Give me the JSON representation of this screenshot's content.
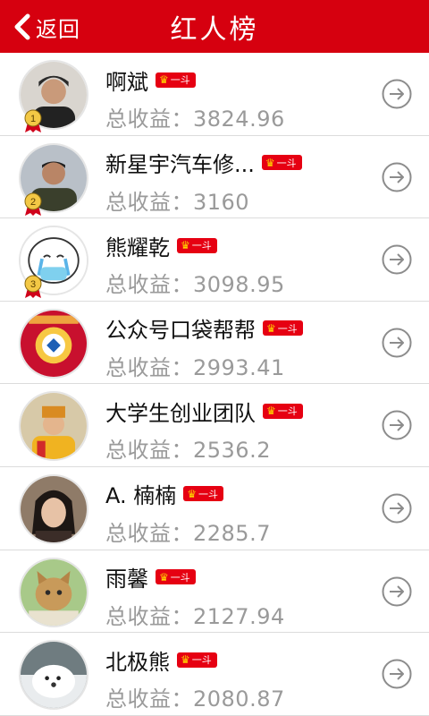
{
  "header": {
    "back_label": "返回",
    "title": "红人榜"
  },
  "income_prefix": "总收益：",
  "users": [
    {
      "name": "啊斌",
      "income": "3824.96",
      "badge": "一斗",
      "rank": "1"
    },
    {
      "name": "新星宇汽车修...",
      "income": "3160",
      "badge": "一斗",
      "rank": "2"
    },
    {
      "name": "熊耀乾",
      "income": "3098.95",
      "badge": "一斗",
      "rank": "3"
    },
    {
      "name": "公众号口袋帮帮",
      "income": "2993.41",
      "badge": "一斗",
      "rank": ""
    },
    {
      "name": "大学生创业团队",
      "income": "2536.2",
      "badge": "一斗",
      "rank": ""
    },
    {
      "name": "A.  楠楠",
      "income": "2285.7",
      "badge": "一斗",
      "rank": ""
    },
    {
      "name": "雨馨",
      "income": "2127.94",
      "badge": "一斗",
      "rank": ""
    },
    {
      "name": "北极熊",
      "income": "2080.87",
      "badge": "一斗",
      "rank": ""
    }
  ],
  "colors": {
    "header_bg": "#d6000f",
    "badge_bg": "#e60012",
    "income_text": "#9a9a9a"
  }
}
